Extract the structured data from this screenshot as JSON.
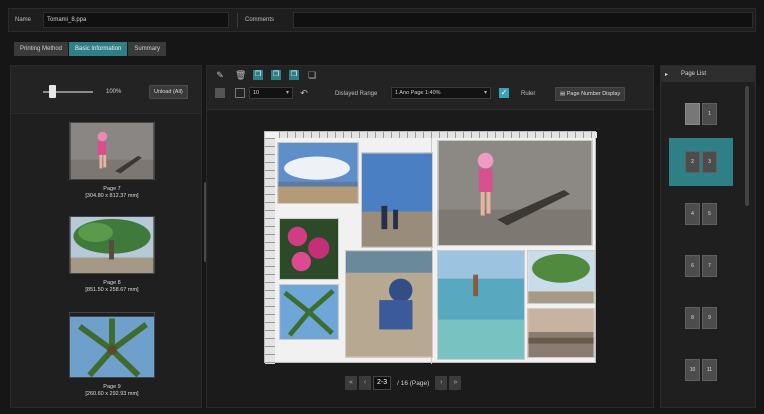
{
  "top_fields": {
    "name_label": "Name",
    "name_value": "Tomami_8.ppa",
    "comments_label": "Comments",
    "comments_value": ""
  },
  "tabs": [
    {
      "label": "Printing Method",
      "active": false
    },
    {
      "label": "Basic Information",
      "active": true
    },
    {
      "label": "Summary",
      "active": false
    }
  ],
  "left_panel": {
    "zoom_percent": "100%",
    "button_label": "Unload (All)",
    "thumbnails": [
      {
        "caption": "Page 7",
        "size": "[304.80 x 812.37 mm]"
      },
      {
        "caption": "Page 8",
        "size": "[851.50 x 258.67 mm]"
      },
      {
        "caption": "Page 9",
        "size": "[260.60 x 292.93 mm]"
      }
    ]
  },
  "center_toolbar": {
    "font_size_value": "10",
    "undo_icon": "undo-icon",
    "display_range_label": "Dislayed Range",
    "display_range_value": "1 Ano Page 1:40%",
    "ruler_label": "Ruler",
    "ruler_checked": true,
    "page_number_button": "Page Number Display"
  },
  "pager": {
    "current": "2-3",
    "total_text": "/ 16 (Page)"
  },
  "right_panel": {
    "title": "Page List",
    "items": [
      {
        "left": "",
        "right": "1",
        "active": false
      },
      {
        "left": "2",
        "right": "3",
        "active": true
      },
      {
        "left": "4",
        "right": "5",
        "active": false
      },
      {
        "left": "6",
        "right": "7",
        "active": false
      },
      {
        "left": "8",
        "right": "9",
        "active": false
      },
      {
        "left": "10",
        "right": "11",
        "active": false
      }
    ]
  },
  "colors": {
    "accent": "#2f7f87",
    "checkbox": "#38a3b5",
    "background": "#161616"
  }
}
